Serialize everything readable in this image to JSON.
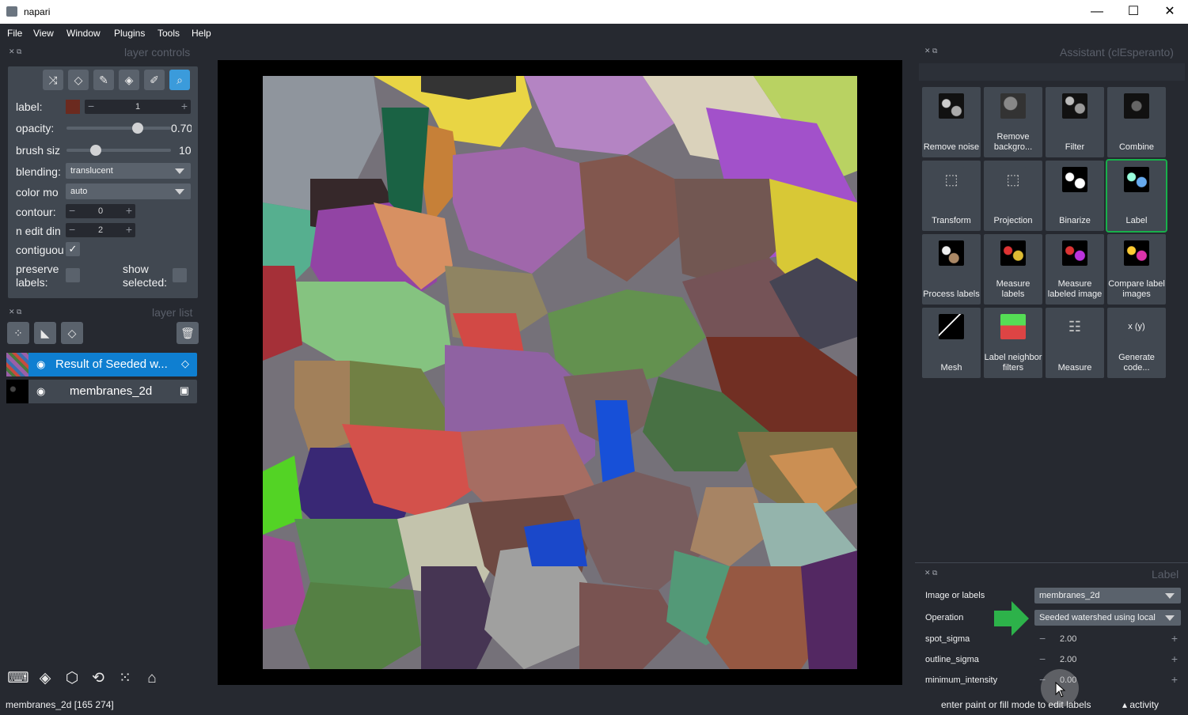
{
  "window": {
    "title": "napari",
    "min": "—",
    "max": "☐",
    "close": "✕"
  },
  "menu": [
    "File",
    "View",
    "Window",
    "Plugins",
    "Tools",
    "Help"
  ],
  "docks": {
    "layer_controls": "layer controls",
    "layer_list": "layer list",
    "assistant": "Assistant (clEsperanto)",
    "label": "Label"
  },
  "layer_controls": {
    "label_label": "label:",
    "label_value": "1",
    "label_color": "#6b2a1f",
    "opacity_label": "opacity:",
    "opacity_value": "0.70",
    "opacity_frac": 0.7,
    "brush_label": "brush siz",
    "brush_value": "10",
    "brush_frac": 0.25,
    "blending_label": "blending:",
    "blending_value": "translucent",
    "colormode_label": "color mo",
    "colormode_value": "auto",
    "contour_label": "contour:",
    "contour_value": "0",
    "nedit_label": "n edit din",
    "nedit_value": "2",
    "contiguous_label": "contiguou",
    "contiguous_checked": "✓",
    "preserve_label": "preserve labels:",
    "show_selected_label": "show selected:"
  },
  "tools": [
    "shuffle-icon",
    "eraser-icon",
    "paintbrush-icon",
    "fill-icon",
    "picker-icon",
    "zoom-icon"
  ],
  "layers": [
    {
      "name": "Result of Seeded w...",
      "type_icon": "label-tag-icon",
      "selected": true
    },
    {
      "name": "membranes_2d",
      "type_icon": "image-icon",
      "selected": false
    }
  ],
  "assistant_buttons": [
    {
      "label": "Remove noise"
    },
    {
      "label": "Remove backgro..."
    },
    {
      "label": "Filter"
    },
    {
      "label": "Combine"
    },
    {
      "label": "Transform"
    },
    {
      "label": "Projection"
    },
    {
      "label": "Binarize"
    },
    {
      "label": "Label"
    },
    {
      "label": "Process labels"
    },
    {
      "label": "Measure labels"
    },
    {
      "label": "Measure labeled image"
    },
    {
      "label": "Compare label images"
    },
    {
      "label": "Mesh"
    },
    {
      "label": "Label neighbor filters"
    },
    {
      "label": "Measure"
    },
    {
      "label": "Generate code..."
    }
  ],
  "label_form": {
    "image_label": "Image or labels",
    "image_value": "membranes_2d",
    "operation_label": "Operation",
    "operation_value": "Seeded watershed using local",
    "spot_label": "spot_sigma",
    "spot_value": "2.00",
    "outline_label": "outline_sigma",
    "outline_value": "2.00",
    "minint_label": "minimum_intensity",
    "minint_value": "0.00"
  },
  "status": {
    "left": "membranes_2d [165 274]",
    "center": "enter paint or fill mode to edit labels",
    "activity": "activity"
  }
}
